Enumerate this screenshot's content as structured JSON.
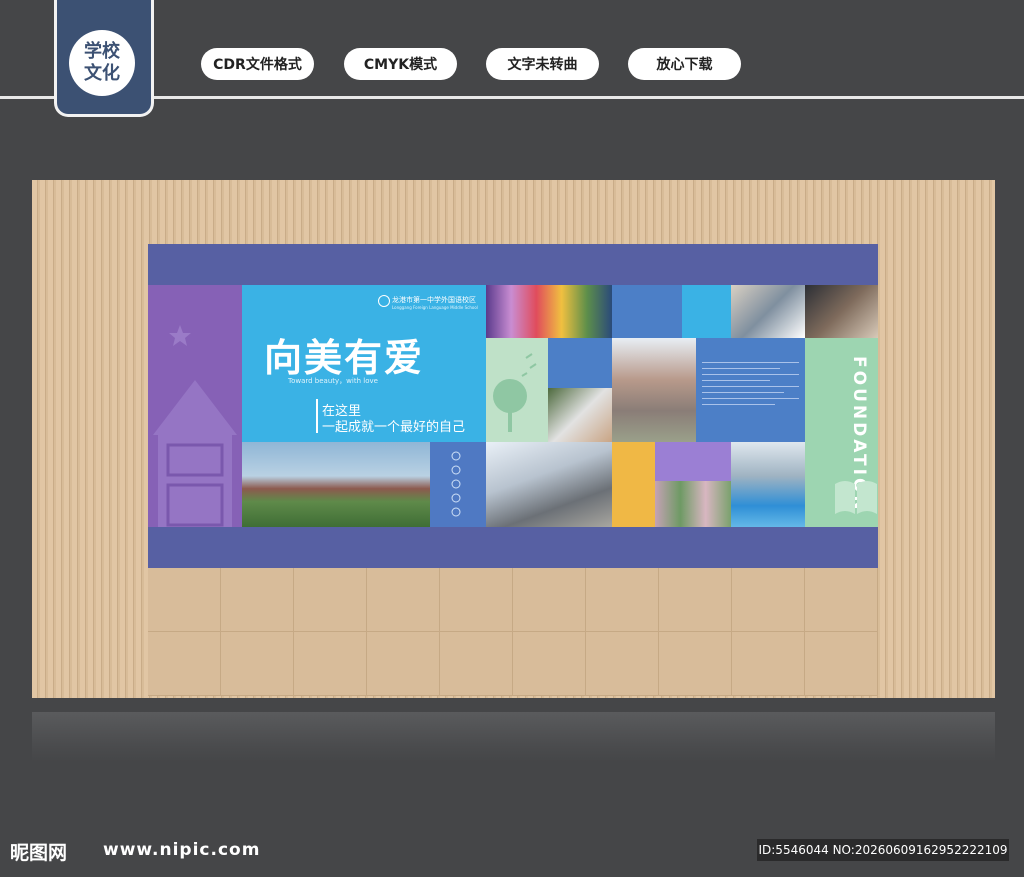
{
  "header": {
    "badge_line1": "学校",
    "badge_line2": "文化",
    "pills": [
      "CDR文件格式",
      "CMYK模式",
      "文字未转曲",
      "放心下载"
    ]
  },
  "board": {
    "school_name": "龙港市第一中学外国语校区",
    "school_name_en": "Longgang Foreign Language Middle School",
    "slogan": "向美有爱",
    "slogan_en": "Toward beauty，with love",
    "line1": "在这里",
    "line2": "一起成就一个最好的自己",
    "foundation": "FOUNDATION"
  },
  "footer": {
    "logo": "昵图网",
    "url": "www.nipic.com",
    "id": "ID:5546044 NO:20260609162952222109"
  },
  "colors": {
    "background": "#454648",
    "badge": "#3c5173",
    "board_band": "#5760a3",
    "purple": "#8661b6",
    "sky_blue": "#3ab2e5",
    "mid_blue": "#4c7fc7",
    "mint": "#9dd5b1",
    "yellow": "#f0b845"
  }
}
